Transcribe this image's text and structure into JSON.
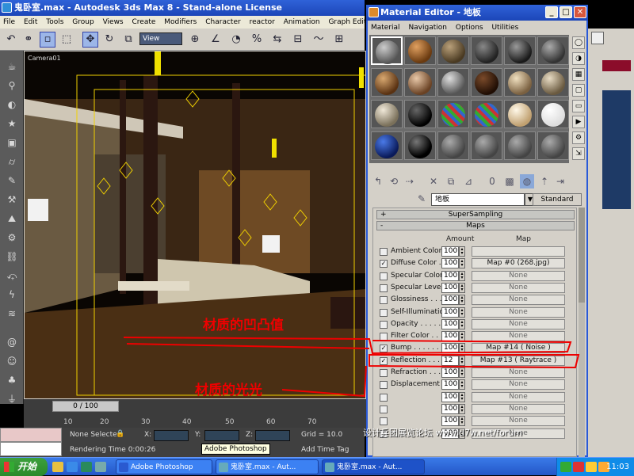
{
  "main_window": {
    "title": "鬼卧室.max - Autodesk 3ds Max 8  - Stand-alone License",
    "menu": [
      "File",
      "Edit",
      "Tools",
      "Group",
      "Views",
      "Create",
      "Modifiers",
      "Character",
      "reactor",
      "Animation",
      "Graph Editors"
    ],
    "toolbar": {
      "view_select": "View"
    },
    "viewport_label": "Camera01"
  },
  "timeline": {
    "slider_text": "0 / 100",
    "ticks": [
      "10",
      "20",
      "30",
      "40",
      "50",
      "60",
      "70"
    ]
  },
  "status": {
    "selection": "None Selecte",
    "x_label": "X:",
    "y_label": "Y:",
    "z_label": "Z:",
    "grid": "Grid = 10.0",
    "rendering_time": "Rendering Time  0:00:26",
    "add_time_tag": "Add Time Tag",
    "tooltip": "Adobe Photoshop"
  },
  "material_editor": {
    "title": "Material Editor - 地板",
    "menu": [
      "Material",
      "Navigation",
      "Options",
      "Utilities"
    ],
    "material_name": "地板",
    "material_type": "Standard",
    "rollouts": {
      "supersampling": "SuperSampling",
      "maps": "Maps"
    },
    "columns": {
      "amount": "Amount",
      "map": "Map"
    },
    "maps": [
      {
        "label": "Ambient Color . .",
        "checked": false,
        "amount": "100",
        "map": "",
        "active": true
      },
      {
        "label": "Diffuse Color . .",
        "checked": true,
        "amount": "100",
        "map": "Map #0 (268.jpg)",
        "active": true
      },
      {
        "label": "Specular Color",
        "checked": false,
        "amount": "100",
        "map": "None",
        "active": true
      },
      {
        "label": "Specular Level .",
        "checked": false,
        "amount": "100",
        "map": "None",
        "active": true
      },
      {
        "label": "Glossiness . . . .",
        "checked": false,
        "amount": "100",
        "map": "None",
        "active": true
      },
      {
        "label": "Self-Illumination .",
        "checked": false,
        "amount": "100",
        "map": "None",
        "active": true
      },
      {
        "label": "Opacity . . . . . .",
        "checked": false,
        "amount": "100",
        "map": "None",
        "active": true
      },
      {
        "label": "Filter Color . . .",
        "checked": false,
        "amount": "100",
        "map": "None",
        "active": true
      },
      {
        "label": "Bump . . . . . . .",
        "checked": true,
        "amount": "100",
        "map": "Map #14  ( Noise )",
        "active": true
      },
      {
        "label": "Reflection . . . . .",
        "checked": true,
        "amount": "12",
        "map": "Map #13  ( Raytrace )",
        "active": true
      },
      {
        "label": "Refraction . . . .",
        "checked": false,
        "amount": "100",
        "map": "None",
        "active": true
      },
      {
        "label": "Displacement . .",
        "checked": false,
        "amount": "100",
        "map": "None",
        "active": true
      },
      {
        "label": "",
        "checked": false,
        "amount": "100",
        "map": "None",
        "active": false
      },
      {
        "label": "",
        "checked": false,
        "amount": "100",
        "map": "None",
        "active": false
      },
      {
        "label": "",
        "checked": false,
        "amount": "100",
        "map": "None",
        "active": false
      },
      {
        "label": "",
        "checked": false,
        "amount": "100",
        "map": "None",
        "active": false
      }
    ]
  },
  "annotations": {
    "bump_note": "材质的凹凸值",
    "reflection_note": "材质的光光",
    "color": "#e00000"
  },
  "watermark": "设计兵团展览论坛  www.d7w.net/forum",
  "taskbar": {
    "start": "开始",
    "tasks": [
      "Adobe Photoshop",
      "鬼卧室.max - Aut...",
      "鬼卧室.max - Aut..."
    ],
    "clock": "11:03"
  }
}
